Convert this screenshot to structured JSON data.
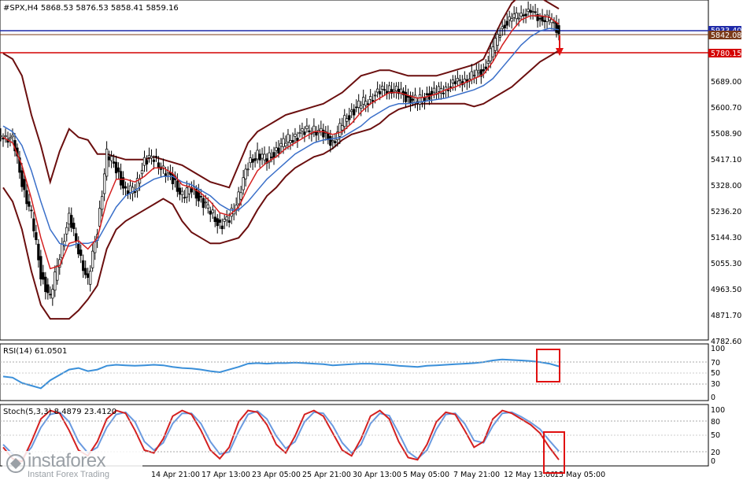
{
  "symbol_header": "#SPX,H4  5868.53 5876.53 5858.41 5859.16",
  "price_axis": [
    "5933.40",
    "5842.08",
    "5780.15",
    "5689.00",
    "5600.70",
    "5508.90",
    "5417.10",
    "5328.00",
    "5236.20",
    "5144.30",
    "5055.30",
    "4963.50",
    "4871.70",
    "4782.60"
  ],
  "price_tags": {
    "blue": "5933.40",
    "brown": "5842.08",
    "red": "5780.15"
  },
  "rsi": {
    "header": "RSI(14) 61.0501",
    "levels": [
      "100",
      "70",
      "50",
      "30",
      "0"
    ]
  },
  "stoch": {
    "header": "Stoch(5,3,3) 8.4879 23.4120",
    "levels": [
      "100",
      "80",
      "50",
      "20",
      "0"
    ]
  },
  "time_axis": [
    "14 Apr 21:00",
    "17 Apr 13:00",
    "23 Apr 05:00",
    "25 Apr 21:00",
    "30 Apr 13:00",
    "5 May 05:00",
    "7 May 21:00",
    "12 May 13:00",
    "15 May 05:00"
  ],
  "watermark": {
    "brand": "instaforex",
    "tagline": "Instant Forex Trading"
  },
  "colors": {
    "candles": "#000000",
    "bollinger": "#6b0f0f",
    "ma_fast": "#d42020",
    "ma_slow": "#3a6fc9",
    "level_blue": "#1f2aa8",
    "level_red": "#d40000",
    "rsi_line": "#3a8fd9",
    "stoch_main": "#d42020",
    "stoch_signal": "#6a9ae0",
    "annotation": "#e01010"
  },
  "chart_data": {
    "type": "candlestick",
    "timeframe": "H4",
    "close_points": [
      5490,
      5470,
      5320,
      5200,
      4990,
      4900,
      5060,
      5190,
      5080,
      4960,
      5150,
      5420,
      5370,
      5280,
      5300,
      5390,
      5410,
      5360,
      5330,
      5270,
      5300,
      5250,
      5220,
      5160,
      5190,
      5270,
      5380,
      5420,
      5400,
      5430,
      5470,
      5480,
      5500,
      5510,
      5490,
      5460,
      5530,
      5570,
      5600,
      5620,
      5640,
      5660,
      5640,
      5620,
      5610,
      5630,
      5640,
      5660,
      5670,
      5690,
      5700,
      5720,
      5800,
      5880,
      5900,
      5930,
      5920,
      5910,
      5900,
      5859
    ],
    "ma_fast": [
      5480,
      5460,
      5380,
      5260,
      5120,
      5010,
      5020,
      5100,
      5110,
      5080,
      5120,
      5250,
      5330,
      5330,
      5320,
      5340,
      5370,
      5370,
      5350,
      5310,
      5300,
      5280,
      5250,
      5210,
      5200,
      5230,
      5300,
      5360,
      5390,
      5410,
      5440,
      5460,
      5480,
      5500,
      5500,
      5490,
      5500,
      5530,
      5570,
      5600,
      5620,
      5640,
      5640,
      5630,
      5620,
      5625,
      5635,
      5650,
      5660,
      5675,
      5690,
      5705,
      5750,
      5810,
      5860,
      5900,
      5915,
      5915,
      5910,
      5885
    ],
    "ma_slow": [
      5520,
      5500,
      5450,
      5360,
      5250,
      5150,
      5100,
      5090,
      5100,
      5100,
      5110,
      5170,
      5230,
      5270,
      5290,
      5310,
      5330,
      5340,
      5340,
      5320,
      5310,
      5290,
      5270,
      5240,
      5220,
      5220,
      5250,
      5290,
      5330,
      5360,
      5390,
      5420,
      5440,
      5460,
      5470,
      5475,
      5480,
      5500,
      5520,
      5550,
      5570,
      5590,
      5600,
      5600,
      5605,
      5610,
      5615,
      5620,
      5630,
      5640,
      5650,
      5665,
      5690,
      5730,
      5770,
      5810,
      5840,
      5860,
      5870,
      5865
    ],
    "bb_upper": [
      5780,
      5760,
      5700,
      5560,
      5450,
      5320,
      5430,
      5510,
      5480,
      5470,
      5420,
      5420,
      5410,
      5400,
      5400,
      5400,
      5410,
      5400,
      5390,
      5380,
      5360,
      5340,
      5320,
      5310,
      5300,
      5380,
      5460,
      5500,
      5520,
      5540,
      5560,
      5570,
      5580,
      5590,
      5600,
      5620,
      5640,
      5670,
      5700,
      5710,
      5720,
      5720,
      5710,
      5700,
      5700,
      5700,
      5700,
      5710,
      5720,
      5730,
      5740,
      5760,
      5830,
      5900,
      5960,
      5990,
      5990,
      5980,
      5960,
      5940
    ],
    "bb_lower": [
      5300,
      5250,
      5150,
      5000,
      4880,
      4830,
      4830,
      4830,
      4860,
      4900,
      4950,
      5080,
      5150,
      5180,
      5200,
      5220,
      5240,
      5260,
      5240,
      5180,
      5140,
      5120,
      5100,
      5100,
      5110,
      5120,
      5160,
      5220,
      5270,
      5300,
      5340,
      5370,
      5390,
      5410,
      5420,
      5440,
      5470,
      5490,
      5500,
      5510,
      5530,
      5560,
      5580,
      5590,
      5600,
      5600,
      5600,
      5600,
      5600,
      5600,
      5590,
      5600,
      5620,
      5640,
      5660,
      5690,
      5720,
      5750,
      5770,
      5790
    ],
    "levels": [
      5933.4,
      5842.08,
      5780.15
    ],
    "rsi_values": [
      42,
      40,
      30,
      25,
      20,
      35,
      45,
      55,
      58,
      52,
      55,
      62,
      64,
      63,
      62,
      63,
      64,
      63,
      60,
      58,
      57,
      55,
      52,
      50,
      55,
      60,
      66,
      67,
      66,
      67,
      67,
      68,
      67,
      66,
      65,
      63,
      64,
      65,
      66,
      66,
      65,
      64,
      62,
      61,
      60,
      62,
      63,
      64,
      65,
      66,
      67,
      69,
      72,
      74,
      73,
      72,
      71,
      69,
      66,
      61
    ],
    "stoch_main": [
      30,
      10,
      5,
      40,
      80,
      95,
      90,
      60,
      25,
      15,
      40,
      80,
      95,
      90,
      60,
      25,
      20,
      45,
      85,
      95,
      88,
      60,
      25,
      10,
      30,
      75,
      95,
      92,
      70,
      35,
      20,
      50,
      88,
      95,
      85,
      55,
      25,
      15,
      45,
      85,
      95,
      80,
      40,
      12,
      8,
      35,
      75,
      92,
      88,
      60,
      30,
      40,
      80,
      95,
      90,
      80,
      70,
      55,
      30,
      8
    ],
    "stoch_signal": [
      35,
      18,
      10,
      30,
      65,
      88,
      92,
      75,
      40,
      20,
      30,
      65,
      88,
      92,
      75,
      40,
      25,
      38,
      72,
      90,
      90,
      72,
      40,
      18,
      22,
      58,
      88,
      94,
      80,
      50,
      28,
      40,
      75,
      92,
      90,
      68,
      38,
      20,
      35,
      72,
      90,
      86,
      55,
      22,
      10,
      25,
      62,
      88,
      90,
      72,
      42,
      38,
      68,
      90,
      92,
      84,
      74,
      62,
      42,
      23
    ]
  }
}
